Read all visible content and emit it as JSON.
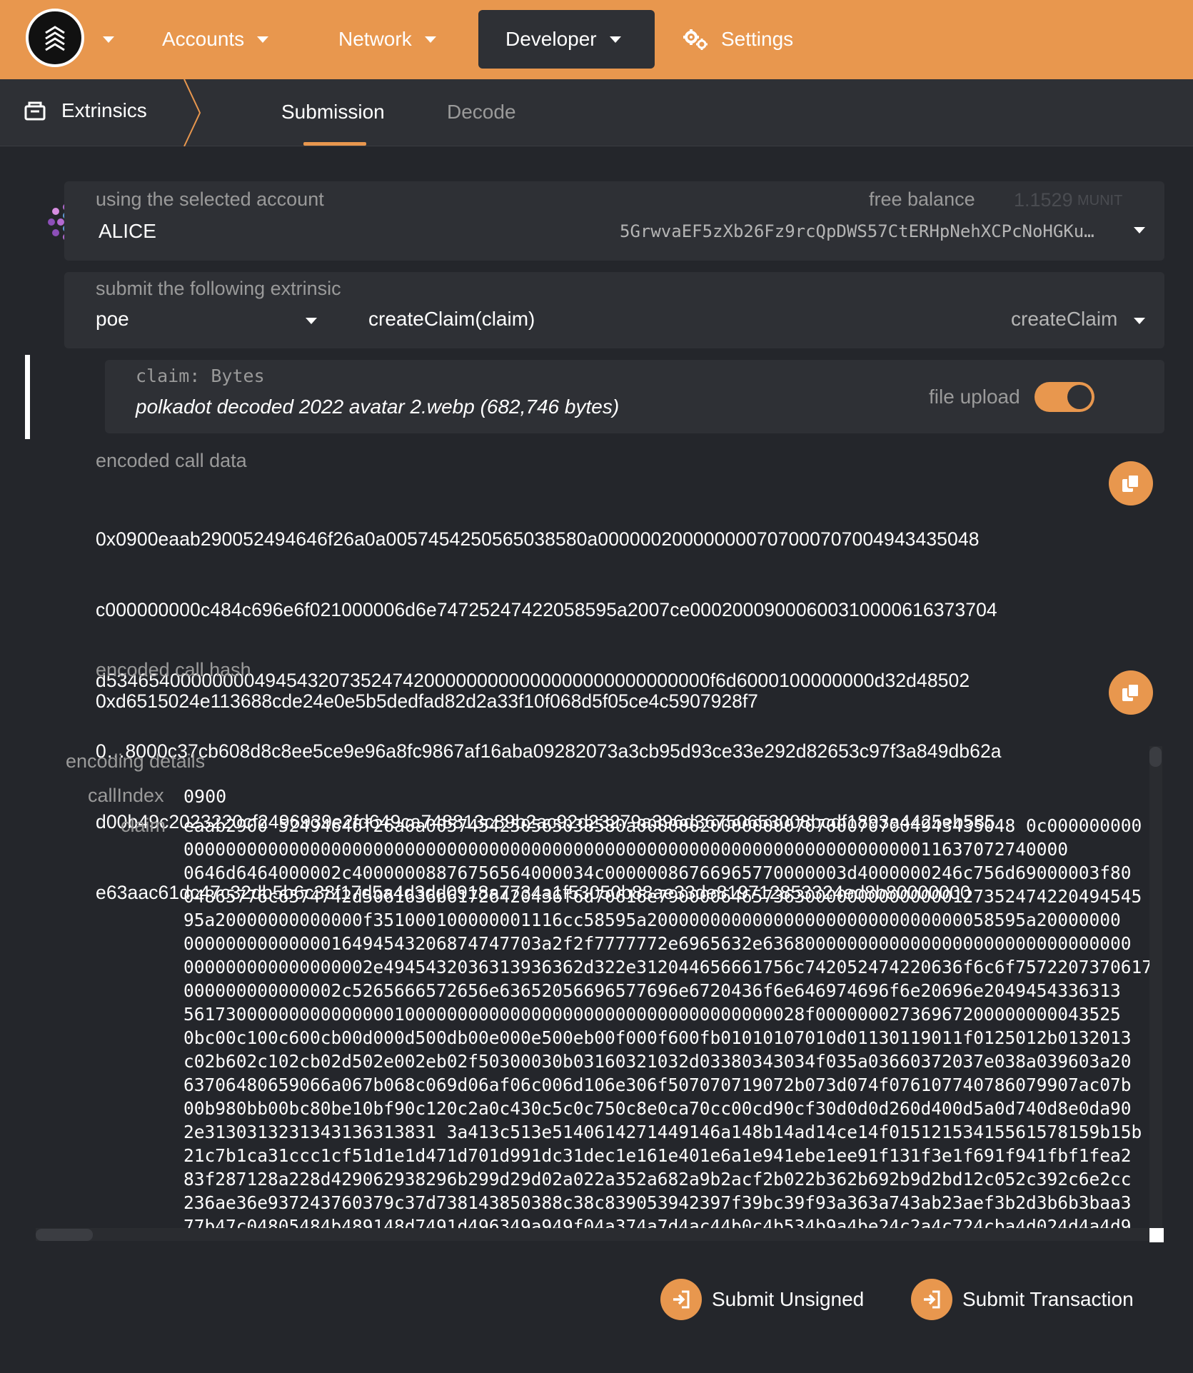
{
  "nav": {
    "accounts": "Accounts",
    "network": "Network",
    "developer": "Developer",
    "settings": "Settings"
  },
  "subnav": {
    "title": "Extrinsics",
    "tabs": [
      "Submission",
      "Decode"
    ]
  },
  "account": {
    "label": "using the selected account",
    "name": "ALICE",
    "balance_label": "free balance",
    "balance_value": "1.1529",
    "balance_unit": "MUNIT",
    "address": "5GrwvaEF5zXb26Fz9rcQpDWS57CtERHpNehXCPcNoHGKu…"
  },
  "extrinsic": {
    "label": "submit the following extrinsic",
    "module": "poe",
    "call": "createClaim(claim)",
    "method": "createClaim"
  },
  "param": {
    "label": "claim: Bytes",
    "value": "polkadot decoded 2022 avatar 2.webp (682,746 bytes)",
    "file_upload_label": "file upload",
    "file_upload_on": true
  },
  "call_data": {
    "label": "encoded call data",
    "lines": [
      "0x0900eaab290052494646f26a0a0057454250565038580a000000200000000707000707004943435048",
      "c000000000c484c696e6f021000006d6e74725247422058595a2007ce00020009000600310000616373704",
      "d534654000000004945432073524742000000000000000000000000000f6d6000100000000d32d48502",
      "0…8000c37cb608d8c8ee5ce9e96a8fc9867af16aba09282073a3cb95d93ce33e292d82653c97f3a849db62a",
      "d00b49c2023220cf2496939e2fd649ca748813c89b2ac92d23279a396d36750653008bcdf1893a4425eb585",
      "e63aac61dc47c32db5b6c38f17d5a4d3dd0918a7734a1f53050b88ae33de819712853324ed8b80000000"
    ]
  },
  "call_hash": {
    "label": "encoded call hash",
    "value": "0xd6515024e113688cde24e0e5b5dedfad82d2a33f10f068d5f05ce4c5907928f7"
  },
  "encoding": {
    "label": "encoding details",
    "callIndex_label": "callIndex",
    "callIndex": "0900",
    "claim_label": "claim",
    "claim_lines": [
      "eaab2900 52494646f26a0a0057454250565038580a000000200000000707000707004943435048 0c000000000",
      "000000000000000000000000000000000000000000000000000000000000000000000011637072740000",
      "0646d6464000002c40000008876756564000034c00000086766965770000003d4000000246c756d69000003f80",
      "04865776c6574742d5061636b61726420436f6d70616e7900006465736300000000000000127352474220494545",
      "95a20000000000000f351000100000001116cc58595a200000000000000000000000000000058595a20000000",
      "0000000000000016494543206874747703a2f2f7777772e6965632e63680000000000000000000000000000000",
      "000000000000000002e4945432036313936362d322e312044656661756c742052474220636f6c6f7572207370617",
      "000000000000002c5265666572656e63652056696577696e6720436f6e646974696f6e20696e2049454336313",
      "56173000000000000000100000000000000000000000000000000000028f00000002736967200000000043525",
      "0bc00c100c600cb00d000d500db00e000e500eb00f000f600fb01010107010d01130119011f0125012b0132013",
      "c02b602c102cb02d502e002eb02f50300030b03160321032d03380343034f035a03660372037e038a039603a20",
      "63706480659066a067b068c069d06af06c006d106e306f507070719072b073d074f076107740786079907ac07b",
      "00b980bb00bc80be10bf90c120c2a0c430c5c0c750c8e0ca70cc00cd90cf30d0d0d260d400d5a0d740d8e0da90",
      "2e3130313231343136313831 3a413c513e5140614271449146a148b14ad14ce14f01512153415561578159b15b",
      "21c7b1ca31ccc1cf51d1e1d471d701d991dc31dec1e161e401e6a1e941ebe1ee91f131f3e1f691f941fbf1fea2",
      "83f287128a228d429062938296b299d29d02a022a352a682a9b2acf2b022b362b692b9d2bd12c052c392c6e2cc",
      "236ae36e937243760379c37d738143850388c38c839053942397f39bc39f93a363a743ab23aef3b2d3b6b3baa3",
      "77b47c04805484b489148d7491d496349a949f04a374a7d4ac44b0c4b534b9a4be24c2a4c724cba4d024d4a4d9"
    ]
  },
  "actions": {
    "submit_unsigned": "Submit Unsigned",
    "submit_transaction": "Submit Transaction"
  },
  "colors": {
    "accent": "#e8974e",
    "background": "#24262b",
    "panel": "#2e3035"
  }
}
